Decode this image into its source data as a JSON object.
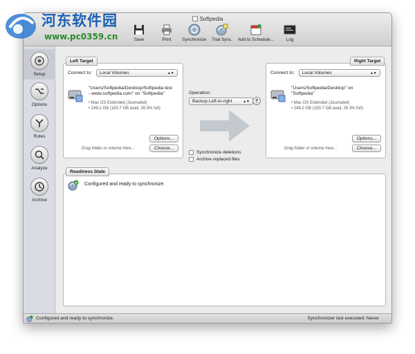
{
  "window": {
    "title": "Softpedia"
  },
  "watermark": {
    "name": "河东软件园",
    "url": "www.pc0359.cn"
  },
  "toolbar": [
    {
      "label": "Save",
      "icon": "floppy-icon"
    },
    {
      "label": "Print",
      "icon": "printer-icon"
    },
    {
      "label": "Synchronize",
      "icon": "sync-icon"
    },
    {
      "label": "Trial Sync.",
      "icon": "trial-sync-icon"
    },
    {
      "label": "Add to Schedule...",
      "icon": "calendar-icon"
    },
    {
      "label": "Log",
      "icon": "log-icon"
    }
  ],
  "sidebar": [
    {
      "label": "Setup",
      "icon": "setup-icon"
    },
    {
      "label": "Options",
      "icon": "options-icon"
    },
    {
      "label": "Rules",
      "icon": "rules-icon"
    },
    {
      "label": "Analyze",
      "icon": "analyze-icon"
    },
    {
      "label": "Archive",
      "icon": "archive-icon"
    }
  ],
  "left_target": {
    "tab": "Left Target",
    "connect_label": "Connect to:",
    "connect_value": "Local Volumes",
    "path_line1": "\"Users/Softpedia/Desktop/Softpedia test",
    "path_line2": "- www.softpedia.com\" on \"Softpedia\"",
    "fs": "• Mac OS Extended (Journaled)",
    "space": "• 249.2 GB (183.7 GB avail, 26.3% full)",
    "options_btn": "Options...",
    "choose_btn": "Choose...",
    "drag_hint": "Drag folder or volume here..."
  },
  "right_target": {
    "tab": "Right Target",
    "connect_label": "Connect to:",
    "connect_value": "Local Volumes",
    "path_line1": "\"Users/Softpedia/Desktop\" on",
    "path_line2": "\"Softpedia\"",
    "fs": "• Mac OS Extended (Journaled)",
    "space": "• 249.2 GB (183.7 GB avail, 26.3% full)",
    "options_btn": "Options...",
    "choose_btn": "Choose...",
    "drag_hint": "Drag folder or volume here..."
  },
  "operation": {
    "label": "Operation:",
    "value": "Backup Left-to-right",
    "help": "?",
    "sync_deletions": "Synchronize deletions",
    "archive_replaced": "Archive replaced files"
  },
  "readiness": {
    "tab": "Readiness State",
    "message": "Configured and ready to synchronize."
  },
  "status": {
    "left": "Configured and ready to synchronize.",
    "right": "Synchronizer last executed:  Never"
  },
  "colors": {
    "accent": "#1a5fb4",
    "arrow": "#c4c9cf",
    "ok": "#3a9a3a"
  }
}
